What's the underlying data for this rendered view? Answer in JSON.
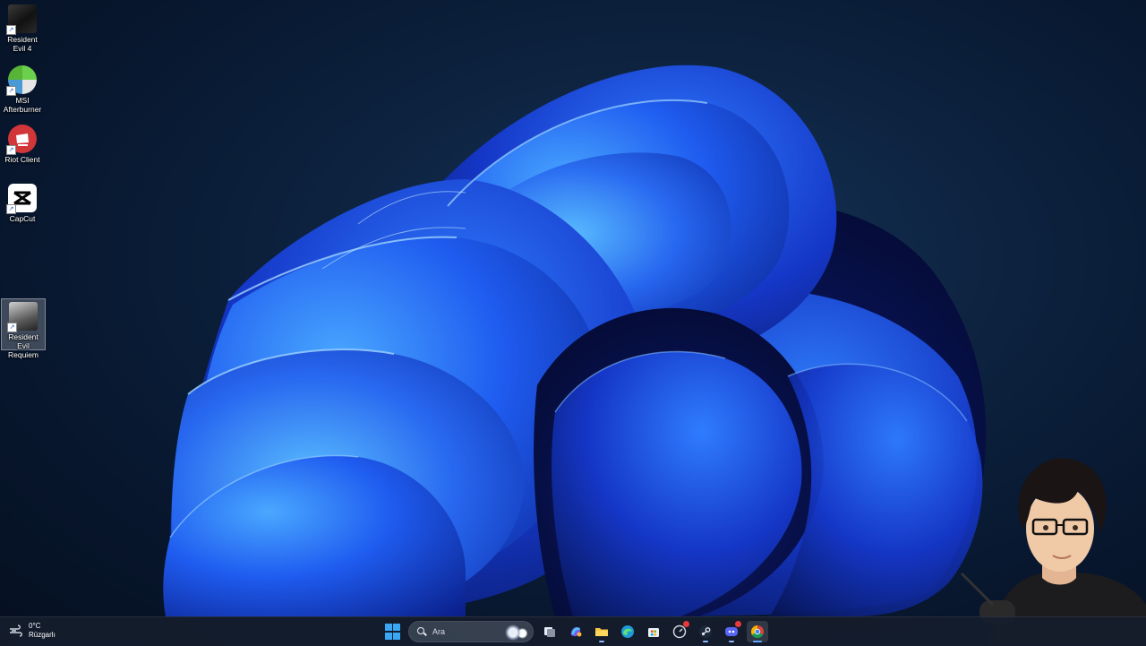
{
  "desktop": {
    "icons": [
      {
        "label": "Resident Evil 4",
        "icon": "resident-evil-4-icon"
      },
      {
        "label": "MSI Afterburner",
        "icon": "msi-afterburner-icon"
      },
      {
        "label": "Riot Client",
        "icon": "riot-client-icon"
      },
      {
        "label": "CapCut",
        "icon": "capcut-icon"
      },
      {
        "label": "Resident Evil Requiem",
        "icon": "resident-evil-requiem-icon",
        "selected": true
      }
    ]
  },
  "taskbar": {
    "weather": {
      "temp": "0°C",
      "condition": "Rüzgarlı",
      "icon": "wind-icon"
    },
    "search": {
      "placeholder": "Ara"
    },
    "apps": [
      {
        "name": "start",
        "icon": "windows-start-icon"
      },
      {
        "name": "search",
        "icon": "search-icon"
      },
      {
        "name": "task-view",
        "icon": "task-view-icon"
      },
      {
        "name": "copilot",
        "icon": "copilot-icon"
      },
      {
        "name": "file-explorer",
        "icon": "folder-icon"
      },
      {
        "name": "edge",
        "icon": "edge-icon"
      },
      {
        "name": "microsoft-store",
        "icon": "store-icon"
      },
      {
        "name": "app-with-badge",
        "icon": "speedometer-icon"
      },
      {
        "name": "steam",
        "icon": "steam-icon"
      },
      {
        "name": "discord",
        "icon": "discord-icon"
      },
      {
        "name": "chrome",
        "icon": "chrome-icon"
      }
    ]
  },
  "colors": {
    "accent": "#3aa7f5",
    "wallpaper_bloom": "#1f5cf0",
    "taskbar": "#161e2c"
  }
}
